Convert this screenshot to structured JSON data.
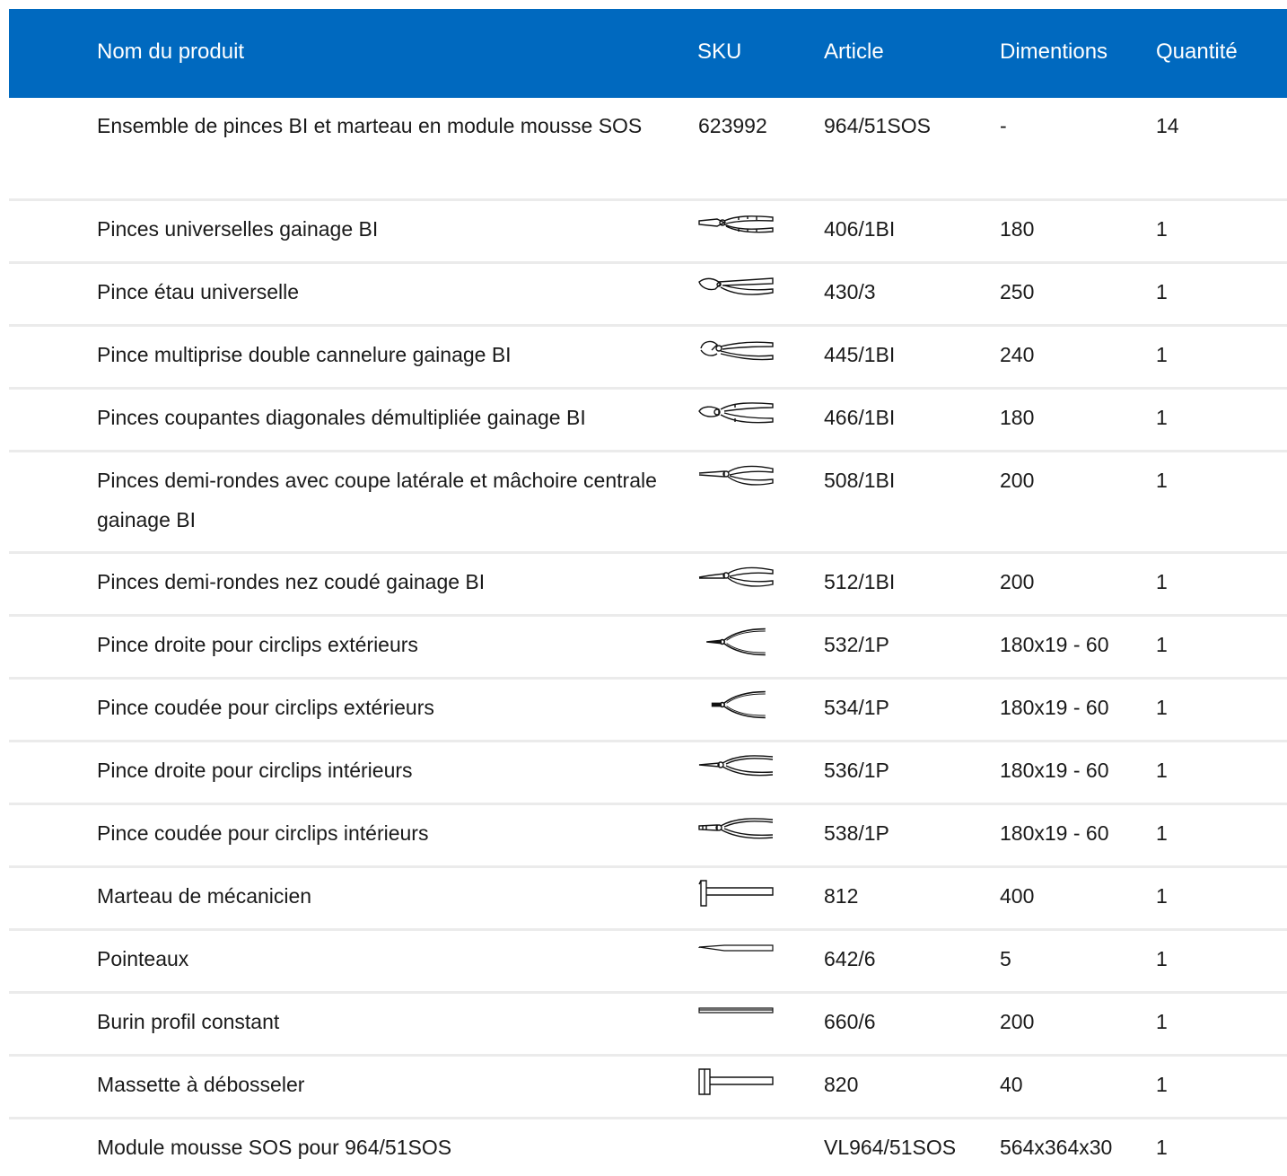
{
  "header": {
    "name": "Nom du produit",
    "sku": "SKU",
    "article": "Article",
    "dimensions": "Dimentions",
    "quantity": "Quantité"
  },
  "rows": [
    {
      "name": "Ensemble de pinces BI et marteau en module mousse SOS",
      "sku": "623992",
      "icon": "",
      "article": "964/51SOS",
      "dimensions": "-",
      "quantity": "14"
    },
    {
      "name": "Pinces universelles gainage BI",
      "sku": "",
      "icon": "combination-pliers-icon",
      "article": "406/1BI",
      "dimensions": "180",
      "quantity": "1"
    },
    {
      "name": "Pince étau universelle",
      "sku": "",
      "icon": "locking-pliers-icon",
      "article": "430/3",
      "dimensions": "250",
      "quantity": "1"
    },
    {
      "name": "Pince multiprise double cannelure gainage BI",
      "sku": "",
      "icon": "water-pump-pliers-icon",
      "article": "445/1BI",
      "dimensions": "240",
      "quantity": "1"
    },
    {
      "name": "Pinces coupantes diagonales démultipliée gainage BI",
      "sku": "",
      "icon": "diagonal-cutters-icon",
      "article": "466/1BI",
      "dimensions": "180",
      "quantity": "1"
    },
    {
      "name": "Pinces demi-rondes avec coupe latérale et mâchoire centrale gainage BI",
      "sku": "",
      "icon": "half-round-pliers-icon",
      "article": "508/1BI",
      "dimensions": "200",
      "quantity": "1"
    },
    {
      "name": "Pinces demi-rondes nez coudé gainage BI",
      "sku": "",
      "icon": "bent-nose-pliers-icon",
      "article": "512/1BI",
      "dimensions": "200",
      "quantity": "1"
    },
    {
      "name": "Pince droite pour circlips extérieurs",
      "sku": "",
      "icon": "circlip-pliers-icon",
      "article": "532/1P",
      "dimensions": "180x19 - 60",
      "quantity": "1"
    },
    {
      "name": "Pince coudée pour circlips extérieurs",
      "sku": "",
      "icon": "circlip-pliers-bent-icon",
      "article": "534/1P",
      "dimensions": "180x19 - 60",
      "quantity": "1"
    },
    {
      "name": "Pince droite pour circlips intérieurs",
      "sku": "",
      "icon": "circlip-pliers-internal-icon",
      "article": "536/1P",
      "dimensions": "180x19 - 60",
      "quantity": "1"
    },
    {
      "name": "Pince coudée pour circlips intérieurs",
      "sku": "",
      "icon": "circlip-pliers-internal-bent-icon",
      "article": "538/1P",
      "dimensions": "180x19 - 60",
      "quantity": "1"
    },
    {
      "name": "Marteau de mécanicien",
      "sku": "",
      "icon": "hammer-icon",
      "article": "812",
      "dimensions": "400",
      "quantity": "1"
    },
    {
      "name": "Pointeaux",
      "sku": "",
      "icon": "center-punch-icon",
      "article": "642/6",
      "dimensions": "5",
      "quantity": "1"
    },
    {
      "name": "Burin profil constant",
      "sku": "",
      "icon": "chisel-icon",
      "article": "660/6",
      "dimensions": "200",
      "quantity": "1"
    },
    {
      "name": "Massette à débosseler",
      "sku": "",
      "icon": "dent-hammer-icon",
      "article": "820",
      "dimensions": "40",
      "quantity": "1"
    },
    {
      "name": "Module mousse SOS pour 964/51SOS",
      "sku": "",
      "icon": "",
      "article": "VL964/51SOS",
      "dimensions": "564x364x30",
      "quantity": "1"
    }
  ],
  "colors": {
    "header_bg": "#0069bf",
    "header_text": "#ffffff",
    "row_border": "#ebebeb"
  }
}
